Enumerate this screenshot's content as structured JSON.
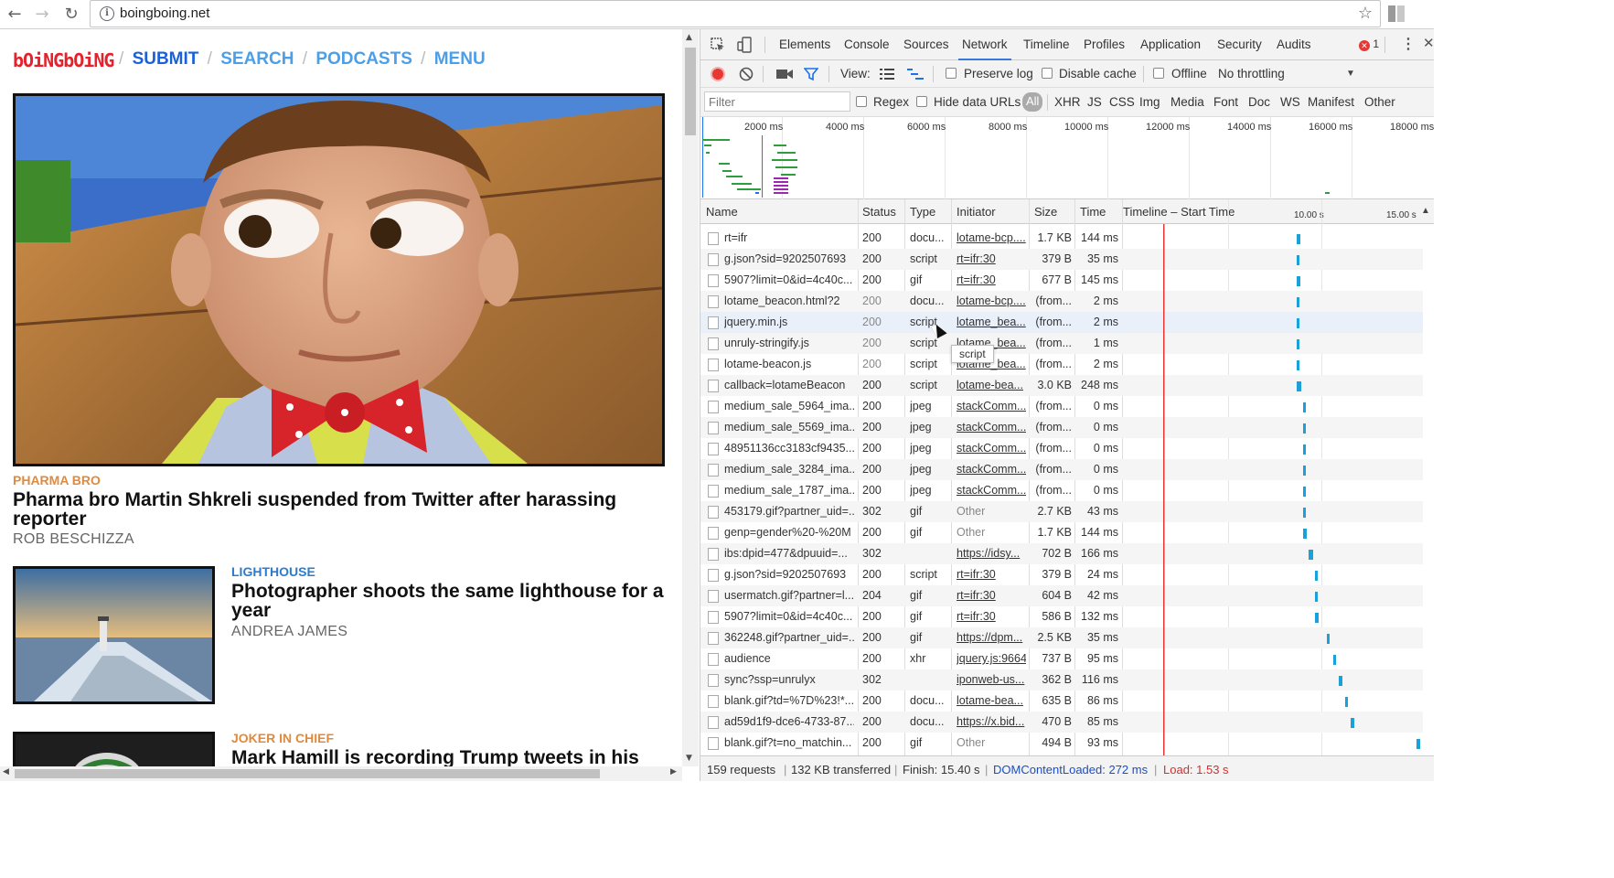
{
  "browser": {
    "url": "boingboing.net",
    "back_icon": "←",
    "forward_icon": "→",
    "reload_icon": "↻",
    "bookmark_icon": "☆"
  },
  "site": {
    "logo": "bOiNGbOiNG",
    "nav": [
      "SUBMIT",
      "SEARCH",
      "PODCASTS",
      "MENU"
    ],
    "nav_sep": "/",
    "colors": {
      "logo": "#e5212b",
      "nav_dark": "#1a61d9",
      "nav_light": "#4b9fe8",
      "cat_orange": "#e08a3c",
      "cat_blue": "#2a7bd1"
    },
    "articles": [
      {
        "category": "PHARMA BRO",
        "headline": "Pharma bro Martin Shkreli suspended from Twitter after harassing reporter",
        "byline": "ROB BESCHIZZA"
      },
      {
        "category": "LIGHTHOUSE",
        "headline": "Photographer shoots the same lighthouse for a year",
        "byline": "ANDREA JAMES"
      },
      {
        "category": "JOKER IN CHIEF",
        "headline": "Mark Hamill is recording Trump tweets in his",
        "byline": ""
      }
    ]
  },
  "devtools": {
    "tabs": [
      "Elements",
      "Console",
      "Sources",
      "Network",
      "Timeline",
      "Profiles",
      "Application",
      "Security",
      "Audits"
    ],
    "active_tab": "Network",
    "error_count": "1",
    "toolbar": {
      "view_label": "View:",
      "preserve_log": "Preserve log",
      "disable_cache": "Disable cache",
      "offline": "Offline",
      "throttling": "No throttling"
    },
    "filter": {
      "placeholder": "Filter",
      "regex": "Regex",
      "hide_data_urls": "Hide data URLs",
      "types": [
        "All",
        "XHR",
        "JS",
        "CSS",
        "Img",
        "Media",
        "Font",
        "Doc",
        "WS",
        "Manifest",
        "Other"
      ]
    },
    "overview_labels": [
      "2000 ms",
      "4000 ms",
      "6000 ms",
      "8000 ms",
      "10000 ms",
      "12000 ms",
      "14000 ms",
      "16000 ms",
      "18000 ms"
    ],
    "columns": [
      "Name",
      "Status",
      "Type",
      "Initiator",
      "Size",
      "Time",
      "Timeline – Start Time"
    ],
    "timeline_ticks": [
      "10.00 s",
      "15.00 s"
    ],
    "rows": [
      {
        "name": "rt=ifr",
        "status": "200",
        "type": "docu...",
        "initiator": "lotame-bcp....",
        "size": "1.7 KB",
        "time": "144 ms",
        "link": true,
        "bar_start": 0.058,
        "bar_len": 0.012,
        "bar_color": "#1ba1d9"
      },
      {
        "name": "g.json?sid=9202507693",
        "status": "200",
        "type": "script",
        "initiator": "rt=ifr:30",
        "size": "379 B",
        "time": "35 ms",
        "link": true,
        "bar_start": 0.058,
        "bar_len": 0.008,
        "bar_color": "#1ba1d9"
      },
      {
        "name": "5907?limit=0&id=4c40c...",
        "status": "200",
        "type": "gif",
        "initiator": "rt=ifr:30",
        "size": "677 B",
        "time": "145 ms",
        "link": true,
        "bar_start": 0.058,
        "bar_len": 0.012,
        "bar_color": "#1ba1d9"
      },
      {
        "name": "lotame_beacon.html?2",
        "status": "200",
        "type": "docu...",
        "initiator": "lotame-bcp....",
        "size": "(from...",
        "time": "2 ms",
        "link": true,
        "bar_start": 0.058,
        "bar_len": 0.006,
        "bar_color": "#1ba1d9"
      },
      {
        "name": "jquery.min.js",
        "status": "200",
        "type": "script",
        "initiator": "lotame_bea...",
        "size": "(from...",
        "time": "2 ms",
        "link": true,
        "bar_start": 0.058,
        "bar_len": 0.006,
        "bar_color": "#1ba1d9"
      },
      {
        "name": "unruly-stringify.js",
        "status": "200",
        "type": "script",
        "initiator": "lotame_bea...",
        "size": "(from...",
        "time": "1 ms",
        "link": true,
        "bar_start": 0.058,
        "bar_len": 0.006,
        "bar_color": "#1ba1d9"
      },
      {
        "name": "lotame-beacon.js",
        "status": "200",
        "type": "script",
        "initiator": "lotame_bea...",
        "size": "(from...",
        "time": "2 ms",
        "link": true,
        "bar_start": 0.058,
        "bar_len": 0.006,
        "bar_color": "#1ba1d9"
      },
      {
        "name": "callback=lotameBeacon",
        "status": "200",
        "type": "script",
        "initiator": "lotame-bea...",
        "size": "3.0 KB",
        "time": "248 ms",
        "link": true,
        "bar_start": 0.058,
        "bar_len": 0.016,
        "bar_color": "#1ba1d9"
      },
      {
        "name": "medium_sale_5964_ima...",
        "status": "200",
        "type": "jpeg",
        "initiator": "stackComm...",
        "size": "(from...",
        "time": "0 ms",
        "link": true,
        "bar_start": 0.06,
        "bar_len": 0.006,
        "bar_color": "#1ba1d9"
      },
      {
        "name": "medium_sale_5569_ima...",
        "status": "200",
        "type": "jpeg",
        "initiator": "stackComm...",
        "size": "(from...",
        "time": "0 ms",
        "link": true,
        "bar_start": 0.06,
        "bar_len": 0.006,
        "bar_color": "#1ba1d9"
      },
      {
        "name": "48951136cc3183cf9435...",
        "status": "200",
        "type": "jpeg",
        "initiator": "stackComm...",
        "size": "(from...",
        "time": "0 ms",
        "link": true,
        "bar_start": 0.06,
        "bar_len": 0.006,
        "bar_color": "#1ba1d9"
      },
      {
        "name": "medium_sale_3284_ima...",
        "status": "200",
        "type": "jpeg",
        "initiator": "stackComm...",
        "size": "(from...",
        "time": "0 ms",
        "link": true,
        "bar_start": 0.06,
        "bar_len": 0.006,
        "bar_color": "#1ba1d9"
      },
      {
        "name": "medium_sale_1787_ima...",
        "status": "200",
        "type": "jpeg",
        "initiator": "stackComm...",
        "size": "(from...",
        "time": "0 ms",
        "link": true,
        "bar_start": 0.06,
        "bar_len": 0.006,
        "bar_color": "#1ba1d9"
      },
      {
        "name": "453179.gif?partner_uid=...",
        "status": "302",
        "type": "gif",
        "initiator": "Other",
        "size": "2.7 KB",
        "time": "43 ms",
        "link": false,
        "bar_start": 0.06,
        "bar_len": 0.008,
        "bar_color": "#1ba1d9"
      },
      {
        "name": "genp=gender%20-%20M",
        "status": "200",
        "type": "gif",
        "initiator": "Other",
        "size": "1.7 KB",
        "time": "144 ms",
        "link": false,
        "bar_start": 0.06,
        "bar_len": 0.012,
        "bar_color": "#1ba1d9"
      },
      {
        "name": "ibs:dpid=477&dpuuid=...",
        "status": "302",
        "type": "",
        "initiator": "https://idsy...",
        "size": "702 B",
        "time": "166 ms",
        "link": true,
        "bar_start": 0.062,
        "bar_len": 0.014,
        "bar_color": "#1ba1d9"
      },
      {
        "name": "g.json?sid=9202507693",
        "status": "200",
        "type": "script",
        "initiator": "rt=ifr:30",
        "size": "379 B",
        "time": "24 ms",
        "link": true,
        "bar_start": 0.064,
        "bar_len": 0.006,
        "bar_color": "#1ba1d9"
      },
      {
        "name": "usermatch.gif?partner=l...",
        "status": "204",
        "type": "gif",
        "initiator": "rt=ifr:30",
        "size": "604 B",
        "time": "42 ms",
        "link": true,
        "bar_start": 0.064,
        "bar_len": 0.008,
        "bar_color": "#1ba1d9"
      },
      {
        "name": "5907?limit=0&id=4c40c...",
        "status": "200",
        "type": "gif",
        "initiator": "rt=ifr:30",
        "size": "586 B",
        "time": "132 ms",
        "link": true,
        "bar_start": 0.064,
        "bar_len": 0.012,
        "bar_color": "#1ba1d9"
      },
      {
        "name": "362248.gif?partner_uid=...",
        "status": "200",
        "type": "gif",
        "initiator": "https://dpm...",
        "size": "2.5 KB",
        "time": "35 ms",
        "link": true,
        "bar_start": 0.068,
        "bar_len": 0.008,
        "bar_color": "#1ba1d9"
      },
      {
        "name": "audience",
        "status": "200",
        "type": "xhr",
        "initiator": "jquery.js:9664",
        "size": "737 B",
        "time": "95 ms",
        "link": true,
        "bar_start": 0.07,
        "bar_len": 0.01,
        "bar_color": "#1ba1d9"
      },
      {
        "name": "sync?ssp=unrulyx",
        "status": "302",
        "type": "",
        "initiator": "iponweb-us...",
        "size": "362 B",
        "time": "116 ms",
        "link": true,
        "bar_start": 0.072,
        "bar_len": 0.012,
        "bar_color": "#1ba1d9"
      },
      {
        "name": "blank.gif?td=%7D%23!*...",
        "status": "200",
        "type": "docu...",
        "initiator": "lotame-bea...",
        "size": "635 B",
        "time": "86 ms",
        "link": true,
        "bar_start": 0.074,
        "bar_len": 0.01,
        "bar_color": "#1ba1d9"
      },
      {
        "name": "ad59d1f9-dce6-4733-87...",
        "status": "200",
        "type": "docu...",
        "initiator": "https://x.bid...",
        "size": "470 B",
        "time": "85 ms",
        "link": true,
        "bar_start": 0.076,
        "bar_len": 0.01,
        "bar_color": "#1ba1d9"
      },
      {
        "name": "blank.gif?t=no_matchin...",
        "status": "200",
        "type": "gif",
        "initiator": "Other",
        "size": "494 B",
        "time": "93 ms",
        "link": false,
        "bar_start": 0.98,
        "bar_len": 0.01,
        "bar_color": "#1ba1d9"
      }
    ],
    "hover_row_index": 4,
    "tooltip": "script",
    "status": {
      "requests": "159 requests",
      "transferred": "132 KB transferred",
      "finish": "Finish: 15.40 s",
      "dcl": "DOMContentLoaded: 272 ms",
      "load": "Load: 1.53 s",
      "sep": "|"
    }
  }
}
